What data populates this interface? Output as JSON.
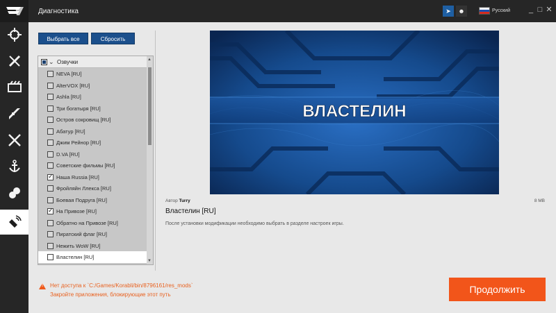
{
  "window": {
    "title": "Диагностика",
    "language": "Русский",
    "minimize": "_",
    "maximize": "□",
    "close": "✕"
  },
  "sidebar": {
    "items": [
      {
        "icon": "crosshair-icon"
      },
      {
        "icon": "tools-icon"
      },
      {
        "icon": "film-icon"
      },
      {
        "icon": "ship-icon"
      },
      {
        "icon": "swords-icon"
      },
      {
        "icon": "anchor-icon"
      },
      {
        "icon": "mods-icon"
      },
      {
        "icon": "satellite-icon"
      }
    ]
  },
  "actions": {
    "select_all": "Выбрать все",
    "reset": "Сбросить"
  },
  "mod_list": {
    "group_label": "Озвучки",
    "items": [
      {
        "label": "NEVA [RU]",
        "checked": false
      },
      {
        "label": "AlterVOX [RU]",
        "checked": false
      },
      {
        "label": "Ashla [RU]",
        "checked": false
      },
      {
        "label": "Три богатыря [RU]",
        "checked": false
      },
      {
        "label": "Остров сокровищ [RU]",
        "checked": false
      },
      {
        "label": "Абатур [RU]",
        "checked": false
      },
      {
        "label": "Джим Рейнор [RU]",
        "checked": false
      },
      {
        "label": "D.VA [RU]",
        "checked": false
      },
      {
        "label": "Советские фильмы [RU]",
        "checked": false
      },
      {
        "label": "Наша Russia [RU]",
        "checked": true
      },
      {
        "label": "Фройляйн Ллекса [RU]",
        "checked": false
      },
      {
        "label": "Боевая Подруга [RU]",
        "checked": false
      },
      {
        "label": "На Привозе [RU]",
        "checked": true
      },
      {
        "label": "Обратно на Привозе [RU]",
        "checked": false
      },
      {
        "label": "Пиратский флаг [RU]",
        "checked": false
      },
      {
        "label": "Нежить WoW [RU]",
        "checked": false
      },
      {
        "label": "Властелин [RU]",
        "checked": false
      }
    ]
  },
  "details": {
    "banner_text": "ВЛАСТЕЛИН",
    "author_prefix": "Автор",
    "author": "Turry",
    "size": "8 MB",
    "title": "Властелин [RU]",
    "description": "После установки модификации необходимо выбрать в разделе настроек игры."
  },
  "footer": {
    "error_line1": "Нет доступа к `C:/Games/Korabli/bin/8796161/res_mods`",
    "error_line2": "Закройте приложения, блокирующие этот путь",
    "continue": "Продолжить"
  },
  "colors": {
    "accent": "#f2551a",
    "button_blue": "#1b4f8c",
    "error": "#e9611f",
    "sidebar_bg": "#262626"
  }
}
